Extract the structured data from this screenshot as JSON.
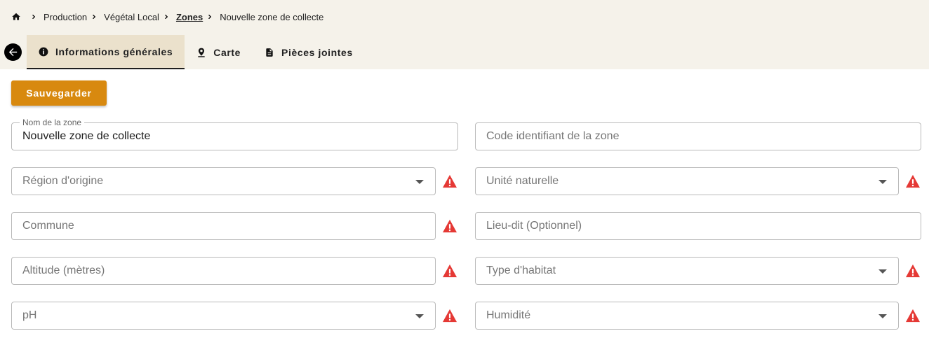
{
  "breadcrumb": {
    "items": [
      "Production",
      "Végétal Local",
      "Zones",
      "Nouvelle zone de collecte"
    ]
  },
  "tabs": [
    {
      "label": "Informations générales",
      "icon": "info-icon",
      "active": true
    },
    {
      "label": "Carte",
      "icon": "map-pin-icon",
      "active": false
    },
    {
      "label": "Pièces jointes",
      "icon": "document-icon",
      "active": false
    }
  ],
  "toolbar": {
    "save_label": "Sauvegarder"
  },
  "form": {
    "nom_zone": {
      "label": "Nom de la zone",
      "value": "Nouvelle zone de collecte"
    },
    "code_zone": {
      "placeholder": "Code identifiant de la zone"
    },
    "region": {
      "placeholder": "Région d'origine"
    },
    "unite": {
      "placeholder": "Unité naturelle"
    },
    "commune": {
      "placeholder": "Commune"
    },
    "lieu_dit": {
      "placeholder": "Lieu-dit (Optionnel)"
    },
    "altitude": {
      "placeholder": "Altitude (mètres)"
    },
    "habitat": {
      "placeholder": "Type d'habitat"
    },
    "ph": {
      "placeholder": "pH"
    },
    "humidite": {
      "placeholder": "Humidité"
    }
  },
  "colors": {
    "topbar": "#f5f2ea",
    "active_tab": "#ebe1cc",
    "accent": "#d8890f",
    "warning": "#e53935"
  }
}
